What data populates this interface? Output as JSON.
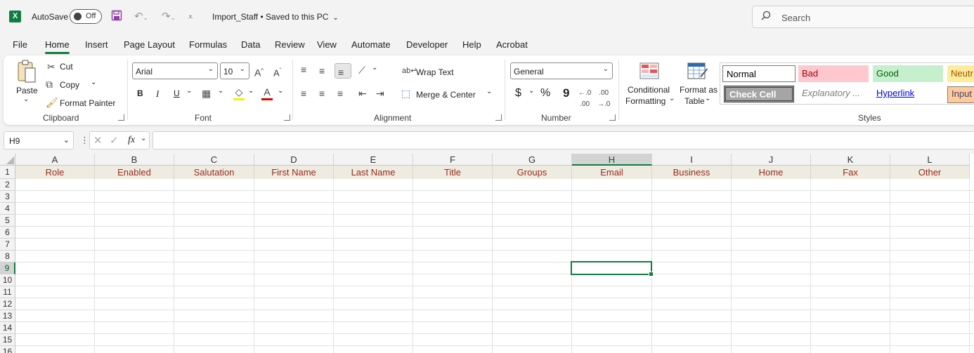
{
  "titlebar": {
    "autosave_label": "AutoSave",
    "autosave_state": "Off",
    "document_title": "Import_Staff • Saved to this PC",
    "search_placeholder": "Search"
  },
  "menu": [
    "File",
    "Home",
    "Insert",
    "Page Layout",
    "Formulas",
    "Data",
    "Review",
    "View",
    "Automate",
    "Developer",
    "Help",
    "Acrobat"
  ],
  "active_menu": "Home",
  "ribbon": {
    "clipboard": {
      "label": "Clipboard",
      "paste": "Paste",
      "cut": "Cut",
      "copy": "Copy",
      "format_painter": "Format Painter"
    },
    "font": {
      "label": "Font",
      "font_name": "Arial",
      "font_size": "10",
      "bold": "B",
      "italic": "I",
      "underline": "U"
    },
    "alignment": {
      "label": "Alignment",
      "wrap_text": "Wrap Text",
      "merge_center": "Merge & Center"
    },
    "number": {
      "label": "Number",
      "format": "General",
      "currency": "$",
      "percent": "%",
      "comma": "9"
    },
    "conditional_formatting": {
      "line1": "Conditional",
      "line2": "Formatting"
    },
    "format_as_table": {
      "line1": "Format as",
      "line2": "Table"
    },
    "styles": {
      "label": "Styles",
      "normal": "Normal",
      "bad": "Bad",
      "good": "Good",
      "neutral": "Neutr",
      "check_cell": "Check Cell",
      "explanatory": "Explanatory ...",
      "hyperlink": "Hyperlink",
      "input": "Input"
    }
  },
  "formula_bar": {
    "name_box": "H9",
    "fx": "fx",
    "formula": ""
  },
  "grid": {
    "columns": [
      "A",
      "B",
      "C",
      "D",
      "E",
      "F",
      "G",
      "H",
      "I",
      "J",
      "K",
      "L"
    ],
    "rows": [
      "1",
      "2",
      "3",
      "4",
      "5",
      "6",
      "7",
      "8",
      "9",
      "10",
      "11",
      "12",
      "13",
      "14",
      "15",
      "16"
    ],
    "header_row": [
      "Role",
      "Enabled",
      "Salutation",
      "First Name",
      "Last Name",
      "Title",
      "Groups",
      "Email",
      "Business",
      "Home",
      "Fax",
      "Other"
    ],
    "selected_cell": "H9"
  },
  "colors": {
    "accent": "#107c41",
    "header_fill": "#eeece1",
    "header_text": "#9c2a1a"
  }
}
